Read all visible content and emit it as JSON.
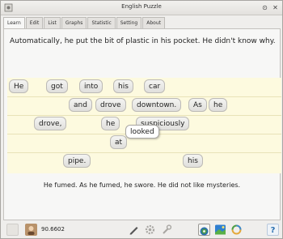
{
  "window": {
    "title": "English Puzzle"
  },
  "window_controls": {
    "restore": "⊙",
    "close": "✕"
  },
  "tabs": [
    {
      "label": "Learn",
      "active": true
    },
    {
      "label": "Edit",
      "active": false
    },
    {
      "label": "List",
      "active": false
    },
    {
      "label": "Graphs",
      "active": false
    },
    {
      "label": "Statistic",
      "active": false
    },
    {
      "label": "Setting",
      "active": false
    },
    {
      "label": "About",
      "active": false
    }
  ],
  "sentence": "Automatically, he put the bit of plastic in his pocket. He didn't know why.",
  "word_tiles": {
    "row1": [
      "He",
      "got",
      "into",
      "his",
      "car"
    ],
    "row2": [
      "and",
      "drove",
      "downtown.",
      "As",
      "he"
    ],
    "row3": [
      "drove,",
      "he",
      "suspiciously"
    ],
    "row4": [
      "at"
    ],
    "row5": [
      "pipe.",
      "his"
    ],
    "dragging": "looked"
  },
  "meaning": "He fumed. As he fumed, he swore. He did not like mysteries.",
  "status": {
    "score": "90.6602",
    "help_label": "?"
  },
  "colors": {
    "board_background": "#fdfadf",
    "tile_background": "#e8e7e4",
    "accent_green": "#4a9a4a"
  },
  "icons": {
    "window": "puzzle-icon",
    "avatar": "avatar-icon",
    "pencil": "pencil-icon",
    "settings": "gear-icon",
    "wrench": "wrench-icon",
    "target": "target-icon",
    "image": "image-icon",
    "refresh": "refresh-icon"
  }
}
